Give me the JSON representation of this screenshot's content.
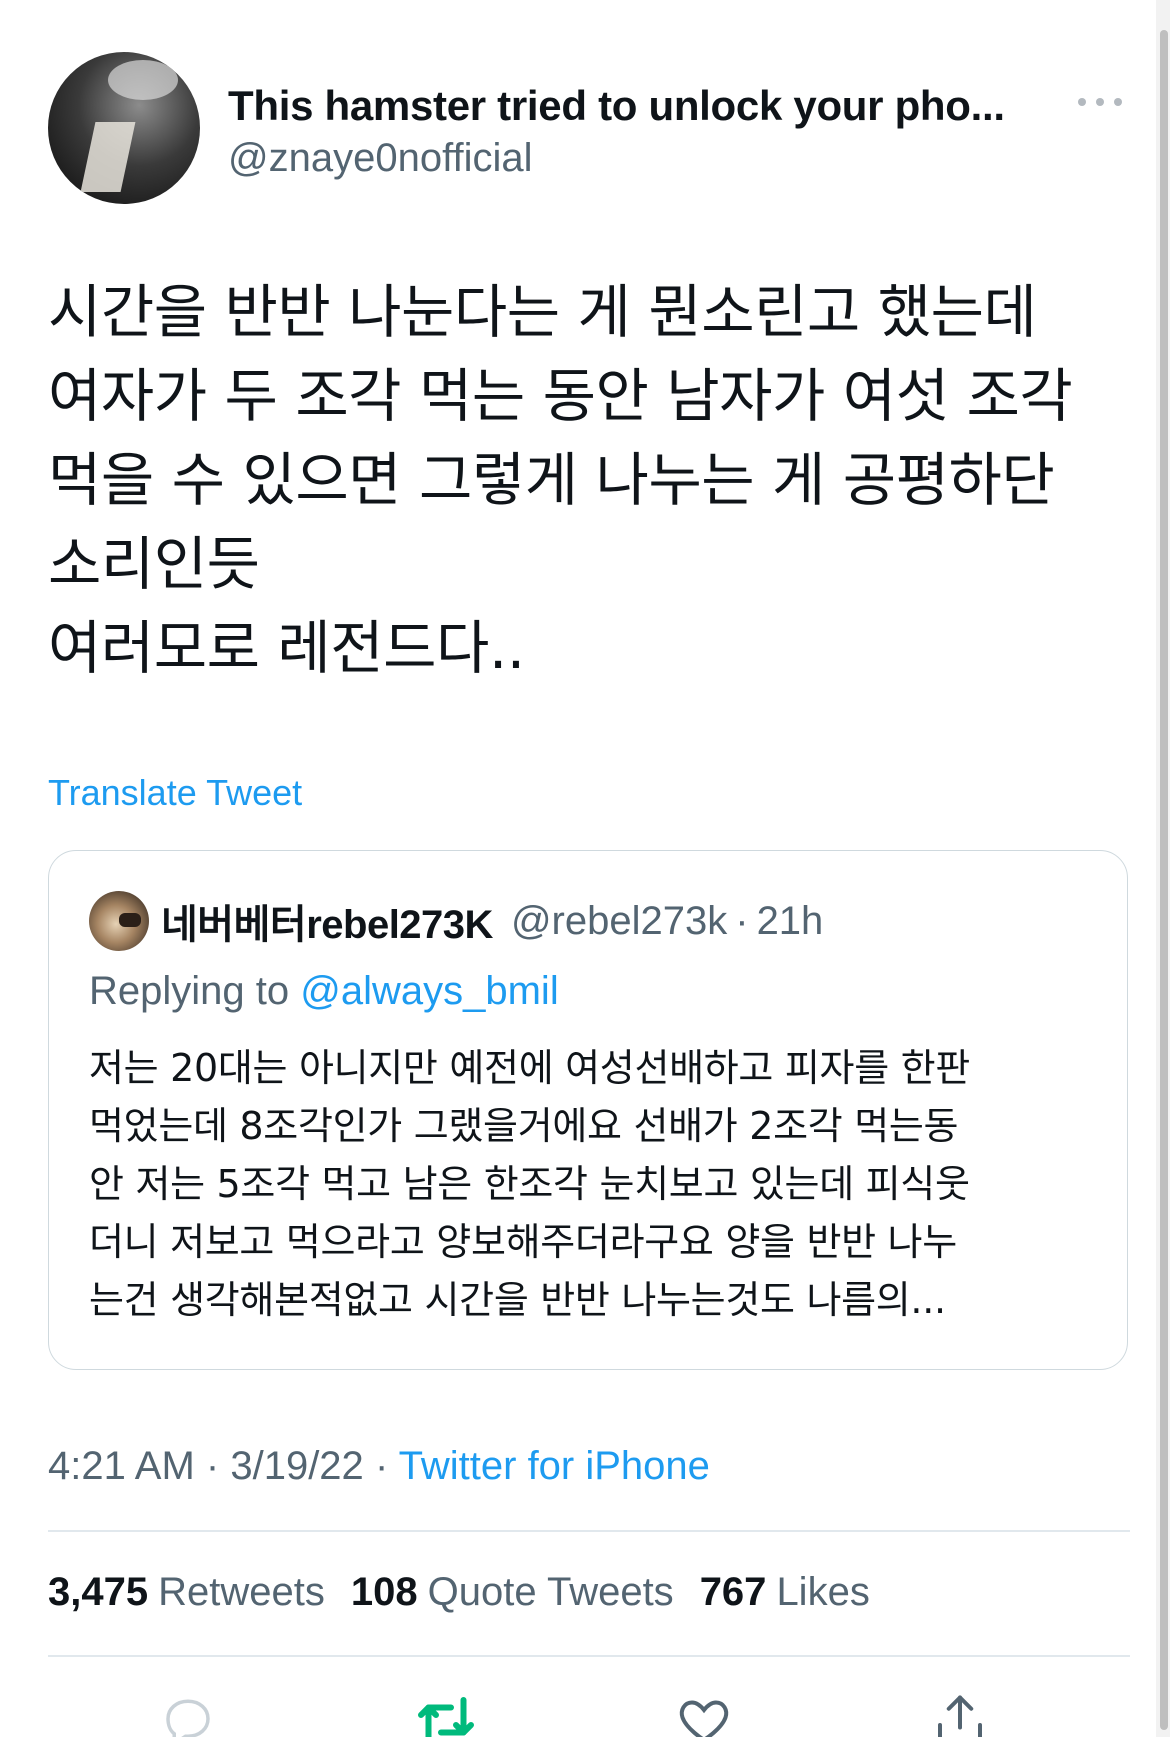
{
  "author": {
    "name": "This hamster tried to unlock your pho...",
    "handle": "@znaye0nofficial"
  },
  "tweet": {
    "text": "시간을 반반 나눈다는 게 뭔소린고 했는데\n여자가 두 조각 먹는 동안 남자가 여섯 조각\n먹을 수 있으면 그렇게 나누는 게 공평하단\n소리인듯\n여러모로 레전드다..",
    "translate_label": "Translate Tweet"
  },
  "quote": {
    "name": "네버베터rebel273K",
    "handle": "@rebel273k",
    "separator": "·",
    "time": "21h",
    "replying_prefix": "Replying to",
    "replying_mention": "@always_bmil",
    "text": "저는 20대는 아니지만 예전에 여성선배하고 피자를 한판\n먹었는데 8조각인가 그랬을거에요 선배가 2조각 먹는동\n안 저는 5조각 먹고 남은 한조각 눈치보고 있는데 피식웃\n더니 저보고 먹으라고 양보해주더라구요 양을 반반 나누\n는건 생각해본적없고 시간을 반반 나누는것도 나름의..."
  },
  "meta": {
    "time": "4:21 AM",
    "separator": "·",
    "date": "3/19/22",
    "source": "Twitter for iPhone"
  },
  "stats": {
    "retweets_count": "3,475",
    "retweets_label": "Retweets",
    "quotes_count": "108",
    "quotes_label": "Quote Tweets",
    "likes_count": "767",
    "likes_label": "Likes"
  },
  "icons": {
    "more": "more-horizontal-icon",
    "reply": "reply-icon",
    "retweet": "retweet-icon",
    "like": "heart-icon",
    "share": "share-icon"
  },
  "colors": {
    "link": "#1d9bf0",
    "secondary_text": "#536471",
    "primary_text": "#0f1419",
    "retweet_active": "#00ba7c"
  }
}
